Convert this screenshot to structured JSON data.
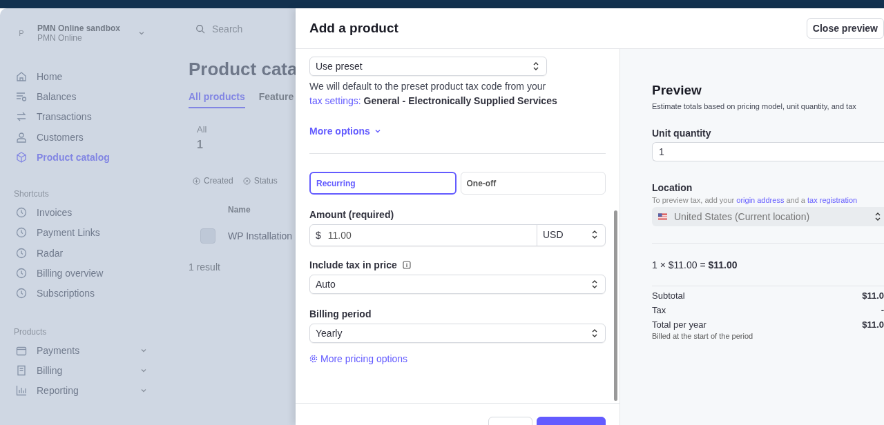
{
  "account": {
    "avatar": "P",
    "name": "PMN Online sandbox",
    "subtitle": "PMN Online"
  },
  "search": {
    "placeholder": "Search"
  },
  "nav": [
    {
      "label": "Home",
      "selected": false
    },
    {
      "label": "Balances",
      "selected": false
    },
    {
      "label": "Transactions",
      "selected": false
    },
    {
      "label": "Customers",
      "selected": false
    },
    {
      "label": "Product catalog",
      "selected": true
    }
  ],
  "shortcuts": {
    "heading": "Shortcuts",
    "items": [
      "Invoices",
      "Payment Links",
      "Radar",
      "Billing overview",
      "Subscriptions"
    ]
  },
  "products": {
    "heading": "Products",
    "items": [
      "Payments",
      "Billing",
      "Reporting"
    ]
  },
  "page": {
    "title": "Product cata",
    "tabs": [
      {
        "label": "All products",
        "selected": true
      },
      {
        "label": "Feature",
        "selected": false
      }
    ],
    "summary": {
      "label": "All",
      "count": "1"
    },
    "filters": [
      "Created",
      "Status"
    ],
    "columns": [
      "Name"
    ],
    "rows": [
      {
        "name": "WP Installation"
      }
    ],
    "result_count": "1 result"
  },
  "modal": {
    "title": "Add a product",
    "close_button": "Close preview",
    "tax_code": {
      "value": "Use preset",
      "note": "We will default to the preset product tax code from your",
      "link": "tax settings:",
      "preset": "General - Electronically Supplied Services"
    },
    "more_options": "More options",
    "price_types": [
      {
        "label": "Recurring",
        "selected": true
      },
      {
        "label": "One-off",
        "selected": false
      }
    ],
    "amount": {
      "label": "Amount (required)",
      "symbol": "$",
      "value": "11.00",
      "currency": "USD"
    },
    "tax_behavior": {
      "label": "Include tax in price",
      "value": "Auto"
    },
    "billing_period": {
      "label": "Billing period",
      "value": "Yearly"
    },
    "more_pricing": "More pricing options"
  },
  "preview": {
    "title": "Preview",
    "subtitle": "Estimate totals based on pricing model, unit quantity, and tax",
    "quantity": {
      "label": "Unit quantity",
      "value": "1"
    },
    "location": {
      "label": "Location",
      "hint": "To preview tax, add your",
      "link_1": "origin address",
      "joiner": "and a",
      "link_2": "tax registration",
      "value": "United States (Current location)"
    },
    "line": {
      "calc": "1 × $11.00 =",
      "total": "$11.00"
    },
    "totals": [
      {
        "label": "Subtotal",
        "value": "$11.0"
      },
      {
        "label": "Tax",
        "value": "-"
      },
      {
        "label": "Total per year",
        "value": "$11.0"
      }
    ],
    "billing_note": "Billed at the start of the period"
  }
}
